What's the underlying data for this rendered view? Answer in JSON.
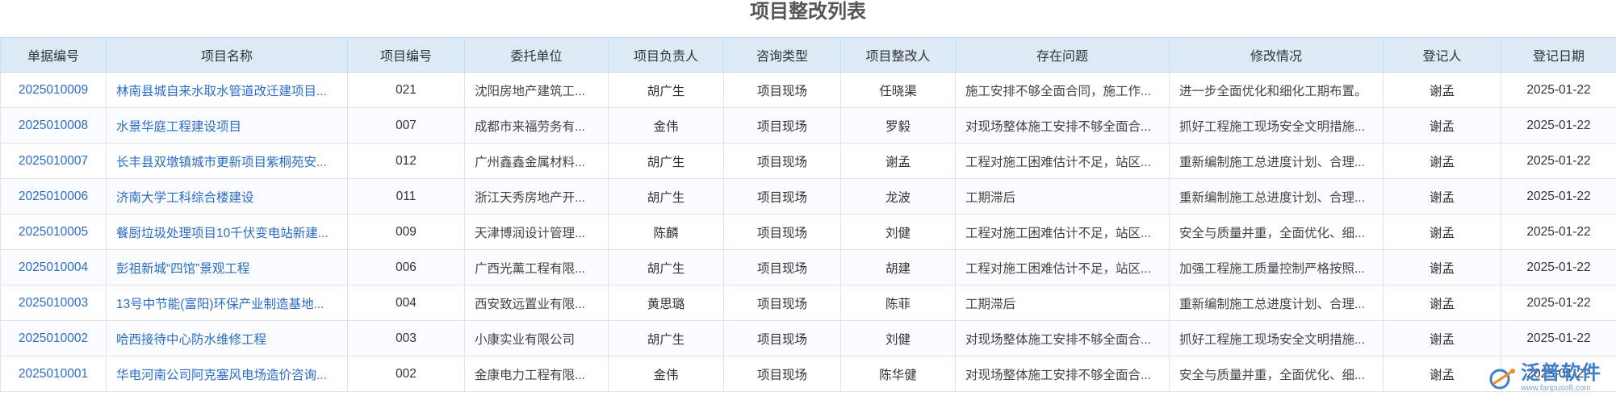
{
  "page": {
    "title": "项目整改列表"
  },
  "table": {
    "headers": [
      "单据编号",
      "项目名称",
      "项目编号",
      "委托单位",
      "项目负责人",
      "咨询类型",
      "项目整改人",
      "存在问题",
      "修改情况",
      "登记人",
      "登记日期"
    ],
    "rows": [
      [
        "2025010009",
        "林南县城自来水取水管道改迁建项目...",
        "021",
        "沈阳房地产建筑工...",
        "胡广生",
        "项目现场",
        "任晓渠",
        "施工安排不够全面合同，施工作...",
        "进一步全面优化和细化工期布置。",
        "谢孟",
        "2025-01-22"
      ],
      [
        "2025010008",
        "水景华庭工程建设项目",
        "007",
        "成都市来福劳务有...",
        "金伟",
        "项目现场",
        "罗毅",
        "对现场整体施工安排不够全面合...",
        "抓好工程施工现场安全文明措施...",
        "谢孟",
        "2025-01-22"
      ],
      [
        "2025010007",
        "长丰县双墩镇城市更新项目紫桐苑安...",
        "012",
        "广州鑫鑫金属材料...",
        "胡广生",
        "项目现场",
        "谢孟",
        "工程对施工困难估计不足，站区...",
        "重新编制施工总进度计划、合理...",
        "谢孟",
        "2025-01-22"
      ],
      [
        "2025010006",
        "济南大学工科综合楼建设",
        "011",
        "浙江天秀房地产开...",
        "胡广生",
        "项目现场",
        "龙波",
        "工期滞后",
        "重新编制施工总进度计划、合理...",
        "谢孟",
        "2025-01-22"
      ],
      [
        "2025010005",
        "餐厨垃圾处理项目10千伏变电站新建...",
        "009",
        "天津博润设计管理...",
        "陈麟",
        "项目现场",
        "刘健",
        "工程对施工困难估计不足，站区...",
        "安全与质量并重，全面优化、细...",
        "谢孟",
        "2025-01-22"
      ],
      [
        "2025010004",
        "彭祖新城“四馆”景观工程",
        "006",
        "广西光薰工程有限...",
        "胡广生",
        "项目现场",
        "胡建",
        "工程对施工困难估计不足，站区...",
        "加强工程施工质量控制严格按照...",
        "谢孟",
        "2025-01-22"
      ],
      [
        "2025010003",
        "13号中节能(富阳)环保产业制造基地...",
        "004",
        "西安致远置业有限...",
        "黄思璐",
        "项目现场",
        "陈菲",
        "工期滞后",
        "重新编制施工总进度计划、合理...",
        "谢孟",
        "2025-01-22"
      ],
      [
        "2025010002",
        "哈西接待中心防水维修工程",
        "003",
        "小康实业有限公司",
        "胡广生",
        "项目现场",
        "刘健",
        "对现场整体施工安排不够全面合...",
        "抓好工程施工现场安全文明措施...",
        "谢孟",
        "2025-01-22"
      ],
      [
        "2025010001",
        "华电河南公司阿克塞风电场造价咨询...",
        "002",
        "金康电力工程有限...",
        "金伟",
        "项目现场",
        "陈华健",
        "对现场整体施工安排不够全面合...",
        "安全与质量并重，全面优化、细...",
        "谢孟",
        "2025-01-22"
      ]
    ]
  },
  "logo": {
    "name": "泛普软件",
    "url_text": "www.fanpusoft.com"
  },
  "colors": {
    "header_bg": "#dceaf6",
    "link": "#2b6cc4",
    "logo": "#3d7fc9"
  }
}
